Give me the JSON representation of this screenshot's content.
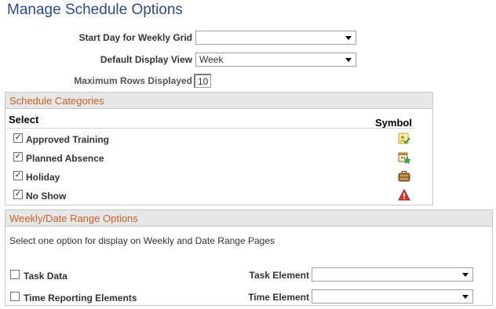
{
  "page": {
    "title": "Manage Schedule Options"
  },
  "options": {
    "start_day_label": "Start Day for Weekly Grid",
    "start_day_value": "",
    "default_view_label": "Default Display View",
    "default_view_value": "Week",
    "max_rows_label": "Maximum Rows Displayed",
    "max_rows_value": "10"
  },
  "categories": {
    "header": "Schedule Categories",
    "select_col": "Select",
    "symbol_col": "Symbol",
    "items": [
      {
        "label": "Approved Training",
        "checked": true,
        "icon": "approved-training-icon"
      },
      {
        "label": "Planned Absence",
        "checked": true,
        "icon": "planned-absence-icon"
      },
      {
        "label": "Holiday",
        "checked": true,
        "icon": "holiday-icon"
      },
      {
        "label": "No Show",
        "checked": true,
        "icon": "no-show-icon"
      }
    ]
  },
  "weekly": {
    "header": "Weekly/Date Range Options",
    "info": "Select one option for display on Weekly and Date Range Pages",
    "task_data_label": "Task Data",
    "task_data_checked": false,
    "time_reporting_label": "Time Reporting Elements",
    "time_reporting_checked": false,
    "task_element_label": "Task Element",
    "task_element_value": "",
    "time_element_label": "Time Element",
    "time_element_value": ""
  },
  "colors": {
    "title": "#2e4a7d",
    "group_header_text": "#c5622a",
    "group_header_bg": "#e6e6e6"
  }
}
